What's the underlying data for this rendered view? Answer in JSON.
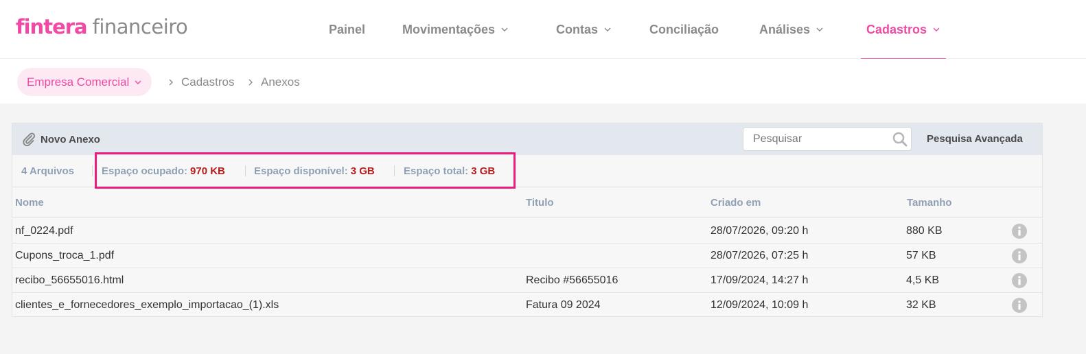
{
  "logo": {
    "brand": "fintera",
    "product": "financeiro"
  },
  "nav": {
    "items": [
      {
        "label": "Painel",
        "has_menu": false,
        "active": false
      },
      {
        "label": "Movimentações",
        "has_menu": true,
        "active": false
      },
      {
        "label": "Contas",
        "has_menu": true,
        "active": false
      },
      {
        "label": "Conciliação",
        "has_menu": false,
        "active": false
      },
      {
        "label": "Análises",
        "has_menu": true,
        "active": false
      },
      {
        "label": "Cadastros",
        "has_menu": true,
        "active": true
      }
    ]
  },
  "breadcrumb": {
    "company": "Empresa Comercial",
    "items": [
      "Cadastros",
      "Anexos"
    ]
  },
  "toolbar": {
    "new_attachment_label": "Novo Anexo",
    "search_placeholder": "Pesquisar",
    "advanced_search_label": "Pesquisa Avançada"
  },
  "stats": {
    "files_count": "4 Arquivos",
    "used_label": "Espaço ocupado:",
    "used_value": "970 KB",
    "available_label": "Espaço disponível:",
    "available_value": "3 GB",
    "total_label": "Espaço total:",
    "total_value": "3 GB"
  },
  "table": {
    "columns": [
      "Nome",
      "Titulo",
      "Criado em",
      "Tamanho"
    ],
    "rows": [
      {
        "nome": "nf_0224.pdf",
        "titulo": "",
        "criado": "28/07/2026, 09:20 h",
        "tamanho": "880 KB"
      },
      {
        "nome": "Cupons_troca_1.pdf",
        "titulo": "",
        "criado": "28/07/2026, 07:25 h",
        "tamanho": "57 KB"
      },
      {
        "nome": "recibo_56655016.html",
        "titulo": "Recibo #56655016",
        "criado": "17/09/2024, 14:27 h",
        "tamanho": "4,5 KB"
      },
      {
        "nome": "clientes_e_fornecedores_exemplo_importacao_(1).xls",
        "titulo": "Fatura 09 2024",
        "criado": "12/09/2024, 10:09 h",
        "tamanho": "32 KB"
      }
    ]
  },
  "colors": {
    "accent": "#f04aa4",
    "highlight": "#ec1c7e",
    "value_red": "#b71c1c",
    "muted_label": "#8fa0b4"
  }
}
